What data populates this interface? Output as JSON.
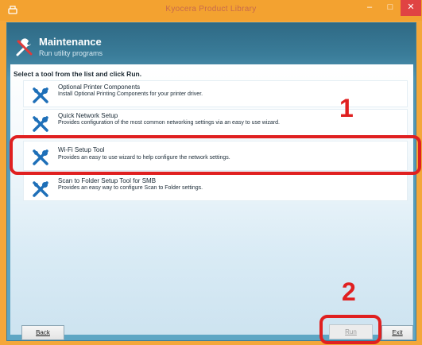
{
  "window": {
    "title": "Kyocera Product Library"
  },
  "header": {
    "title": "Maintenance",
    "subtitle": "Run utility programs"
  },
  "instruction": "Select a tool from the list and click Run.",
  "tools": [
    {
      "name": "Optional Printer Components",
      "description": "Install Optional Printing Components for your printer driver.",
      "icon": "tools-icon"
    },
    {
      "name": "Quick Network Setup",
      "description": "Provides configuration of the most common networking settings via an easy to use wizard.",
      "icon": "tools-icon"
    },
    {
      "name": "Wi-Fi Setup Tool",
      "description": "Provides an easy to use wizard to help configure the network settings.",
      "icon": "tools-icon"
    },
    {
      "name": "Scan to Folder Setup Tool for SMB",
      "description": "Provides an easy way to configure Scan to Folder settings.",
      "icon": "tools-icon"
    }
  ],
  "buttons": {
    "back": "Back",
    "run": "Run",
    "exit": "Exit"
  },
  "callouts": {
    "step1": "1",
    "step2": "2"
  },
  "colors": {
    "titlebar": "#f3a230",
    "close": "#e04343",
    "callout": "#e02020",
    "panel": "#3a7c99"
  }
}
